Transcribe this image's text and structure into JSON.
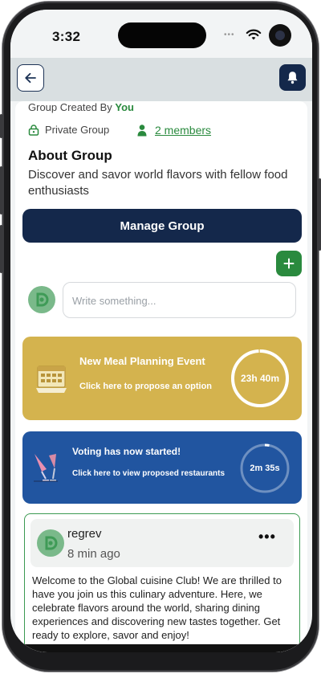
{
  "status_bar": {
    "time": "3:32",
    "dots": "•••"
  },
  "group": {
    "created_by_prefix": "Group Created By ",
    "created_by_name": "You",
    "privacy": "Private Group",
    "members_link": "2 members",
    "about_title": "About Group",
    "about_description": "Discover and savor world flavors with fellow food enthusiasts",
    "manage_button": "Manage Group"
  },
  "composer": {
    "placeholder": "Write something..."
  },
  "event_card": {
    "title": "New Meal Planning Event",
    "subtitle": "Click here to propose an option",
    "timer": "23h 40m",
    "progress": 0.99,
    "color": "#d4b34e"
  },
  "vote_card": {
    "title": "Voting has now started!",
    "subtitle": "Click here to view proposed restaurants",
    "timer": "2m 35s",
    "progress": 0.03,
    "color": "#2155a0"
  },
  "post": {
    "author": "regrev",
    "time": "8 min ago",
    "menu": "•••",
    "body": "Welcome to the Global cuisine Club! We are thrilled to have you join us this culinary adventure. Here, we celebrate flavors around the world, sharing dining experiences and discovering new tastes together. Get ready to explore, savor and enjoy!"
  },
  "colors": {
    "navy": "#14284b",
    "green": "#2a8a3e",
    "appbar": "#d9dfe1"
  },
  "icons": [
    "back-arrow-icon",
    "bell-icon",
    "lock-icon",
    "person-icon",
    "plus-icon",
    "calendar-icon",
    "wine-glass-icon",
    "wifi-icon"
  ]
}
